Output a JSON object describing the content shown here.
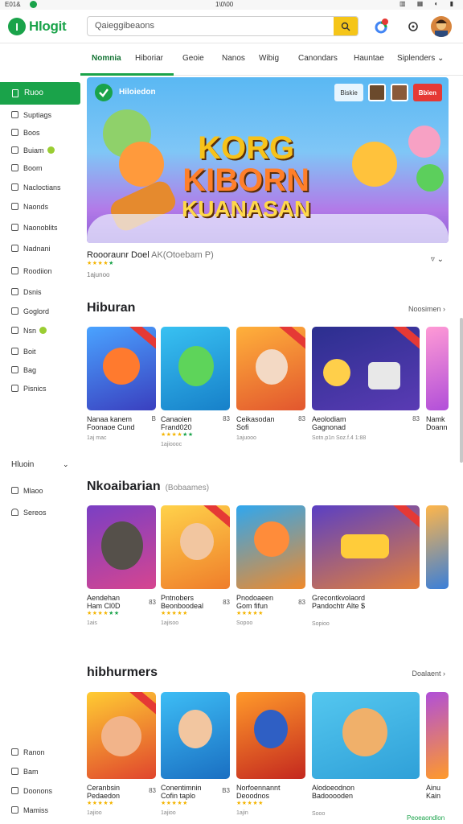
{
  "status_bar": {
    "left": "E01&",
    "center": "1\\0\\00"
  },
  "header": {
    "logo_mark": "I",
    "logo_text": "Hlogit",
    "search_placeholder": "Qaieggibeaons"
  },
  "tabs": [
    "Nomnia",
    "Hiboriar",
    "Geoie",
    "Nanos",
    "Wibig",
    "Canondars",
    "Hauntae",
    "Siplenders"
  ],
  "sidebar": {
    "active": "Ruoo",
    "items": [
      "Suptiags",
      "Boos",
      "Buiam",
      "Boom",
      "Nacloctians",
      "Naonds",
      "Naonoblits",
      "Nadnani",
      "Roodiion",
      "Dsnis",
      "Goglord",
      "Nsn",
      "Boit",
      "Bag",
      "Pisnics"
    ],
    "section_title": "Hluoin",
    "section_items": [
      "Mlaoo",
      "Sereos"
    ],
    "bottom_items": [
      "Ranon",
      "Bam",
      "Doonons",
      "Mamiss"
    ]
  },
  "hero": {
    "label": "Hiloiedon",
    "badge1": "Biskie",
    "badge2": "Bbien",
    "title_line1": "KORG",
    "title_line2": "KIBORN",
    "title_line3": "KUANASAN",
    "caption": "Roooraunr Doel",
    "caption_muted": "AK(Otoebam P)",
    "caption_meta": "1ajunoo"
  },
  "sections": [
    {
      "title": "Hiburan",
      "sub": "",
      "more": "Noosimen",
      "cards": [
        {
          "name": "Nanaa kanem",
          "name2": "Foonaoe Cund",
          "num": "B",
          "meta": "1aj mac"
        },
        {
          "name": "Canaoien",
          "name2": "Frand020",
          "num": "83",
          "meta": "1ajioooc"
        },
        {
          "name": "Ceikasodan",
          "name2": "Sofi",
          "num": "83",
          "meta": "1ajuooo"
        },
        {
          "name": "Aeolodiam",
          "name2": "Gagnonad",
          "num": "83",
          "meta": "Sotn.p1n Soz.f.4 1:88"
        },
        {
          "name": "Namk",
          "name2": "Doann",
          "num": "",
          "meta": ""
        }
      ]
    },
    {
      "title": "Nkoaibarian",
      "sub": "(Bobaames)",
      "more": "",
      "cards": [
        {
          "name": "Aendehan",
          "name2": "Ham Cl0D",
          "num": "83",
          "meta": "1ais"
        },
        {
          "name": "Pntnobers",
          "name2": "Beonboodeal",
          "num": "83",
          "meta": "1ajisoo"
        },
        {
          "name": "Pnodoaeen",
          "name2": "Gom fifun",
          "num": "83",
          "meta": "Sopoo"
        },
        {
          "name": "Grecontkvolaord",
          "name2": "Pandochtr Alte $",
          "num": "",
          "meta": "Sopioo"
        }
      ]
    },
    {
      "title": "hibhurmers",
      "sub": "",
      "more": "Doalaent",
      "cards": [
        {
          "name": "Ceranbsin",
          "name2": "Pedaedon",
          "num": "83",
          "meta": "1ajioo"
        },
        {
          "name": "Conentimnin",
          "name2": "Cofin taplo",
          "num": "B3",
          "meta": "1ajioo"
        },
        {
          "name": "Norfoennannt",
          "name2": "Deoodnos",
          "num": "",
          "meta": "1ajin"
        },
        {
          "name": "Alodoeodnon",
          "name2": "Badooooden",
          "num": "",
          "meta": "Sooo"
        },
        {
          "name": "Ainu",
          "name2": "Kain",
          "num": "",
          "meta": "Peoeaondlon"
        }
      ]
    }
  ],
  "colors": {
    "accent": "#1aa34a",
    "star": "#f4b400",
    "sale_ribbon": "#e53935",
    "search_button": "#f5c518"
  }
}
